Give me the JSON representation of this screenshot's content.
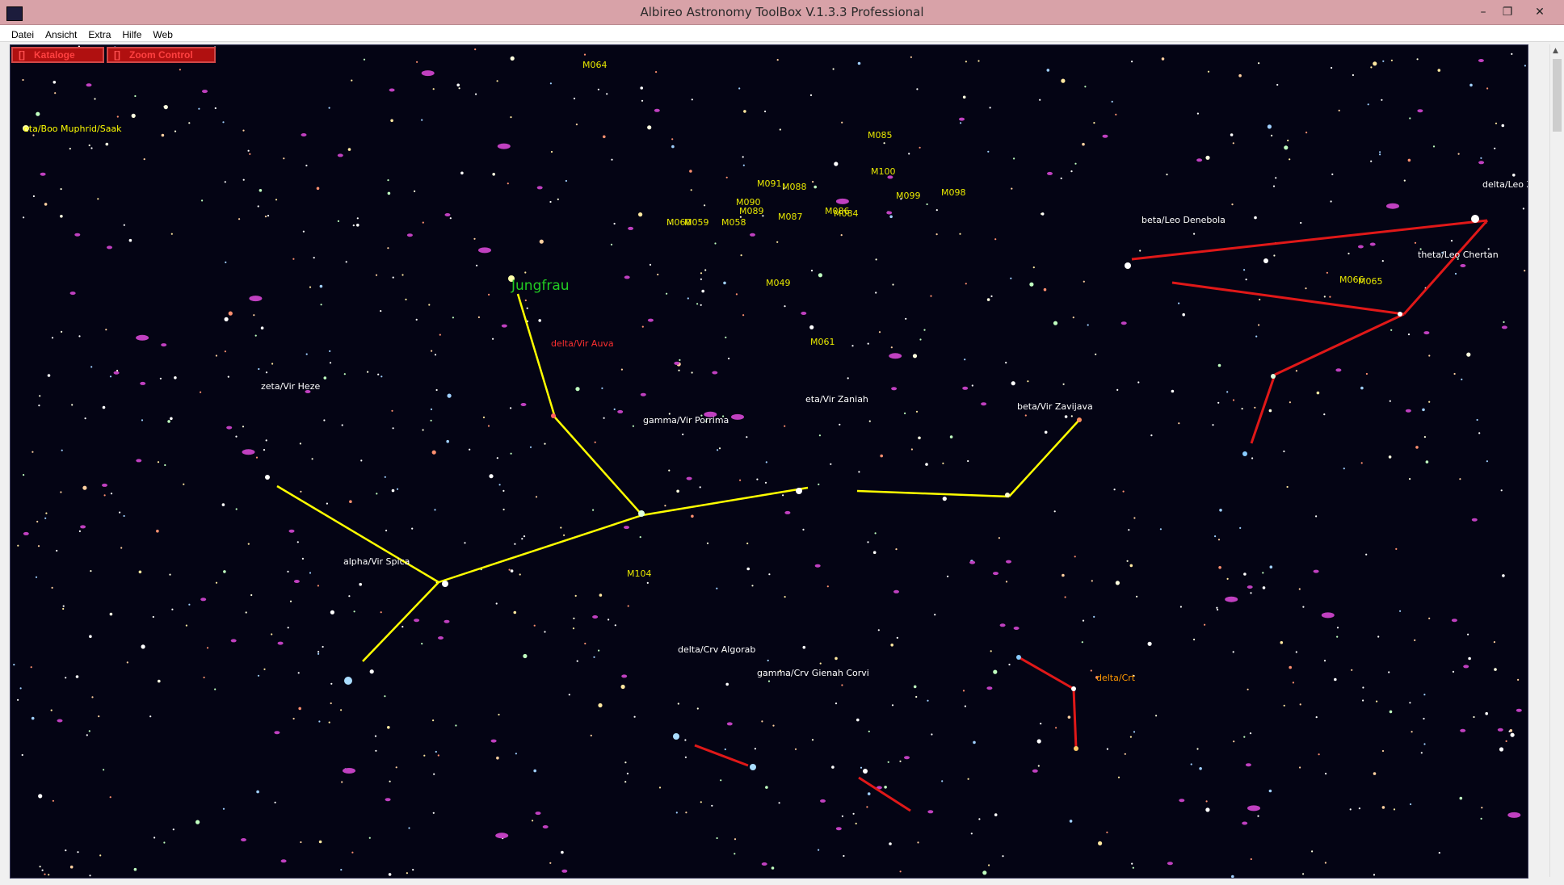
{
  "window": {
    "title": "Albireo Astronomy ToolBox V.1.3.3 Professional",
    "minimize_glyph": "–",
    "restore_glyph": "❐",
    "close_glyph": "✕"
  },
  "menu": [
    "Datei",
    "Ansicht",
    "Extra",
    "Hilfe",
    "Web"
  ],
  "toolbar": {
    "catalogs_label": "Kataloge",
    "zoom_label": "Zoom Control",
    "checkbox_glyph": "[]"
  },
  "colors": {
    "sky_background": "#040414",
    "virgo_lines": "#ffff00",
    "neighbor_lines": "#e01818",
    "star_label": "#ffffff",
    "messier_label": "#e8e800",
    "constellation_label": "#22cc22"
  },
  "constellation_name": "Jungfrau",
  "star_labels": [
    {
      "id": "eta-boo",
      "text": "eta/Boo Muphrid/Saak",
      "color": "#ffff00"
    },
    {
      "id": "delta-vir",
      "text": "delta/Vir Auva",
      "color": "#ff3030"
    },
    {
      "id": "zeta-vir",
      "text": "zeta/Vir Heze",
      "color": "#ffffff"
    },
    {
      "id": "gamma-vir",
      "text": "gamma/Vir Porrima",
      "color": "#ffffff"
    },
    {
      "id": "eta-vir",
      "text": "eta/Vir Zaniah",
      "color": "#ffffff"
    },
    {
      "id": "beta-vir",
      "text": "beta/Vir Zavijava",
      "color": "#ffffff"
    },
    {
      "id": "alpha-vir",
      "text": "alpha/Vir Spica",
      "color": "#ffffff"
    },
    {
      "id": "beta-leo",
      "text": "beta/Leo Denebola",
      "color": "#ffffff"
    },
    {
      "id": "delta-leo",
      "text": "delta/Leo Zos",
      "color": "#ffffff"
    },
    {
      "id": "theta-leo",
      "text": "theta/Leo Chertan",
      "color": "#ffffff"
    },
    {
      "id": "delta-crv",
      "text": "delta/Crv Algorab",
      "color": "#ffffff"
    },
    {
      "id": "gamma-crv",
      "text": "gamma/Crv Gienah Corvi",
      "color": "#ffffff"
    },
    {
      "id": "delta-crt",
      "text": "delta/Crt",
      "color": "#ff9900"
    }
  ],
  "messier": [
    "M064",
    "M085",
    "M100",
    "M091",
    "M088",
    "M090",
    "M089",
    "M087",
    "M086",
    "M084",
    "M099",
    "M098",
    "M060",
    "M059",
    "M058",
    "M049",
    "M061",
    "M066",
    "M065",
    "M104"
  ]
}
